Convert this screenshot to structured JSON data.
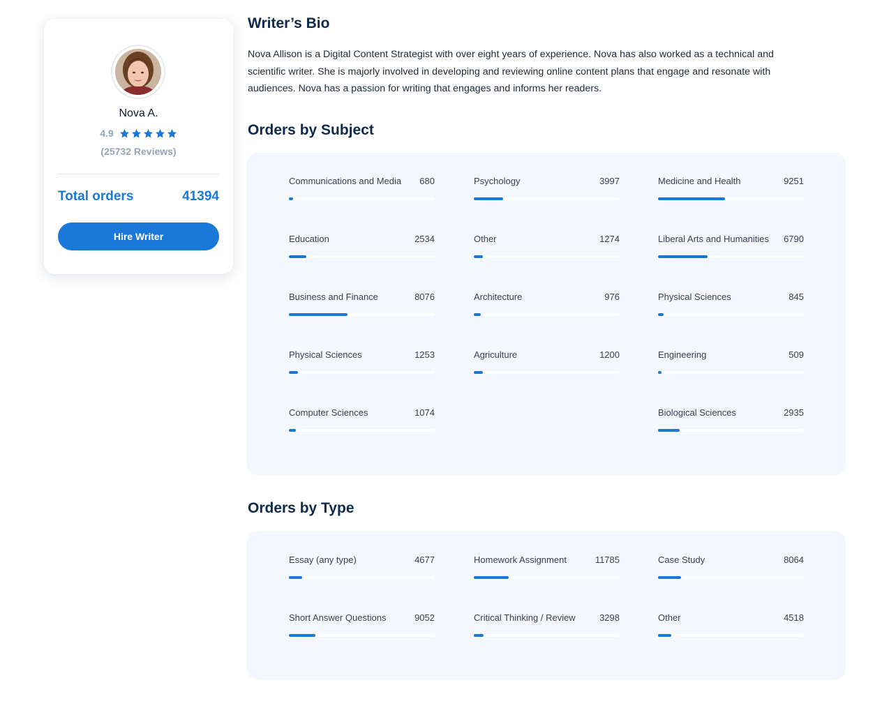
{
  "writer": {
    "name": "Nova A.",
    "rating": "4.9",
    "reviews": "(25732 Reviews)",
    "total_orders_label": "Total orders",
    "total_orders_value": "41394",
    "hire_label": "Hire Writer",
    "stars_filled": 5
  },
  "bio": {
    "title": "Writer’s Bio",
    "text": "Nova Allison is a Digital Content Strategist with over eight years of experience. Nova has also worked as a technical and scientific writer. She is majorly involved in developing and reviewing online content plans that engage and resonate with audiences. Nova has a passion for writing that engages and informs her readers."
  },
  "subjects": {
    "title": "Orders by Subject",
    "items": [
      {
        "label": "Communications and Media",
        "value": "680",
        "fill": 0.03
      },
      {
        "label": "Psychology",
        "value": "3997",
        "fill": 0.2
      },
      {
        "label": "Medicine and Health",
        "value": "9251",
        "fill": 0.46
      },
      {
        "label": "Education",
        "value": "2534",
        "fill": 0.12
      },
      {
        "label": "Other",
        "value": "1274",
        "fill": 0.06
      },
      {
        "label": "Liberal Arts and Humanities",
        "value": "6790",
        "fill": 0.34
      },
      {
        "label": "Business and Finance",
        "value": "8076",
        "fill": 0.4
      },
      {
        "label": "Architecture",
        "value": "976",
        "fill": 0.05
      },
      {
        "label": "Physical Sciences",
        "value": "845",
        "fill": 0.04
      },
      {
        "label": "Physical Sciences",
        "value": "1253",
        "fill": 0.06
      },
      {
        "label": "Agriculture",
        "value": "1200",
        "fill": 0.06
      },
      {
        "label": "Engineering",
        "value": "509",
        "fill": 0.025
      },
      {
        "label": "Computer Sciences",
        "value": "1074",
        "fill": 0.05
      },
      null,
      {
        "label": "Biological Sciences",
        "value": "2935",
        "fill": 0.15
      }
    ]
  },
  "types": {
    "title": "Orders by Type",
    "items": [
      {
        "label": "Essay (any type)",
        "value": "4677",
        "fill": 0.09
      },
      {
        "label": "Homework Assignment",
        "value": "11785",
        "fill": 0.24
      },
      {
        "label": "Case Study",
        "value": "8064",
        "fill": 0.16
      },
      {
        "label": "Short Answer Questions",
        "value": "9052",
        "fill": 0.18
      },
      {
        "label": "Critical Thinking / Review",
        "value": "3298",
        "fill": 0.065
      },
      {
        "label": "Other",
        "value": "4518",
        "fill": 0.09
      }
    ]
  },
  "colors": {
    "accent": "#1978d8",
    "heading": "#0f2a4a",
    "panel_bg": "#f4f7fd",
    "muted": "#94a3b8"
  }
}
